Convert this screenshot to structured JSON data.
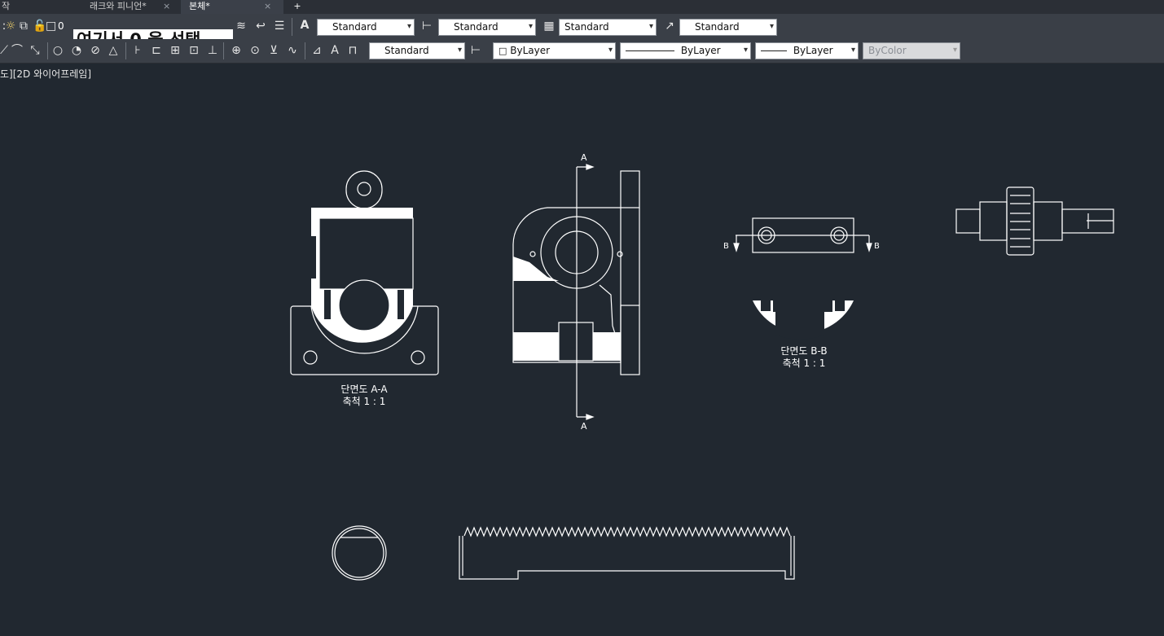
{
  "tabs": [
    {
      "label": "작",
      "active": false
    },
    {
      "label": "래크와 피니언*",
      "active": false
    },
    {
      "label": "본체*",
      "active": true
    }
  ],
  "tab_close_glyph": "×",
  "new_tab_glyph": "+",
  "toolbar1": {
    "layer_state": "0",
    "layer_prompt": "여기서 0 을 선택",
    "text_style": "Standard",
    "dim_style": "Standard",
    "table_style": "Standard",
    "mleader_style": "Standard"
  },
  "toolbar2": {
    "style_combo": "Standard",
    "color": "ByLayer",
    "linetype": "ByLayer",
    "lineweight": "ByLayer",
    "plot_style": "ByColor"
  },
  "viewport_label": "도][2D 와이어프레임]",
  "drawing": {
    "section_aa_caption": "단면도 A-A",
    "section_aa_scale": "축척 1 : 1",
    "section_bb_caption": "단면도 B-B",
    "section_bb_scale": "축척 1 : 1",
    "cut_a_top": "A",
    "cut_a_bottom": "A",
    "cut_b_left": "B",
    "cut_b_right": "B"
  },
  "colors": {
    "canvas": "#212830",
    "toolbar": "#3a3f47",
    "line": "#ffffff"
  }
}
